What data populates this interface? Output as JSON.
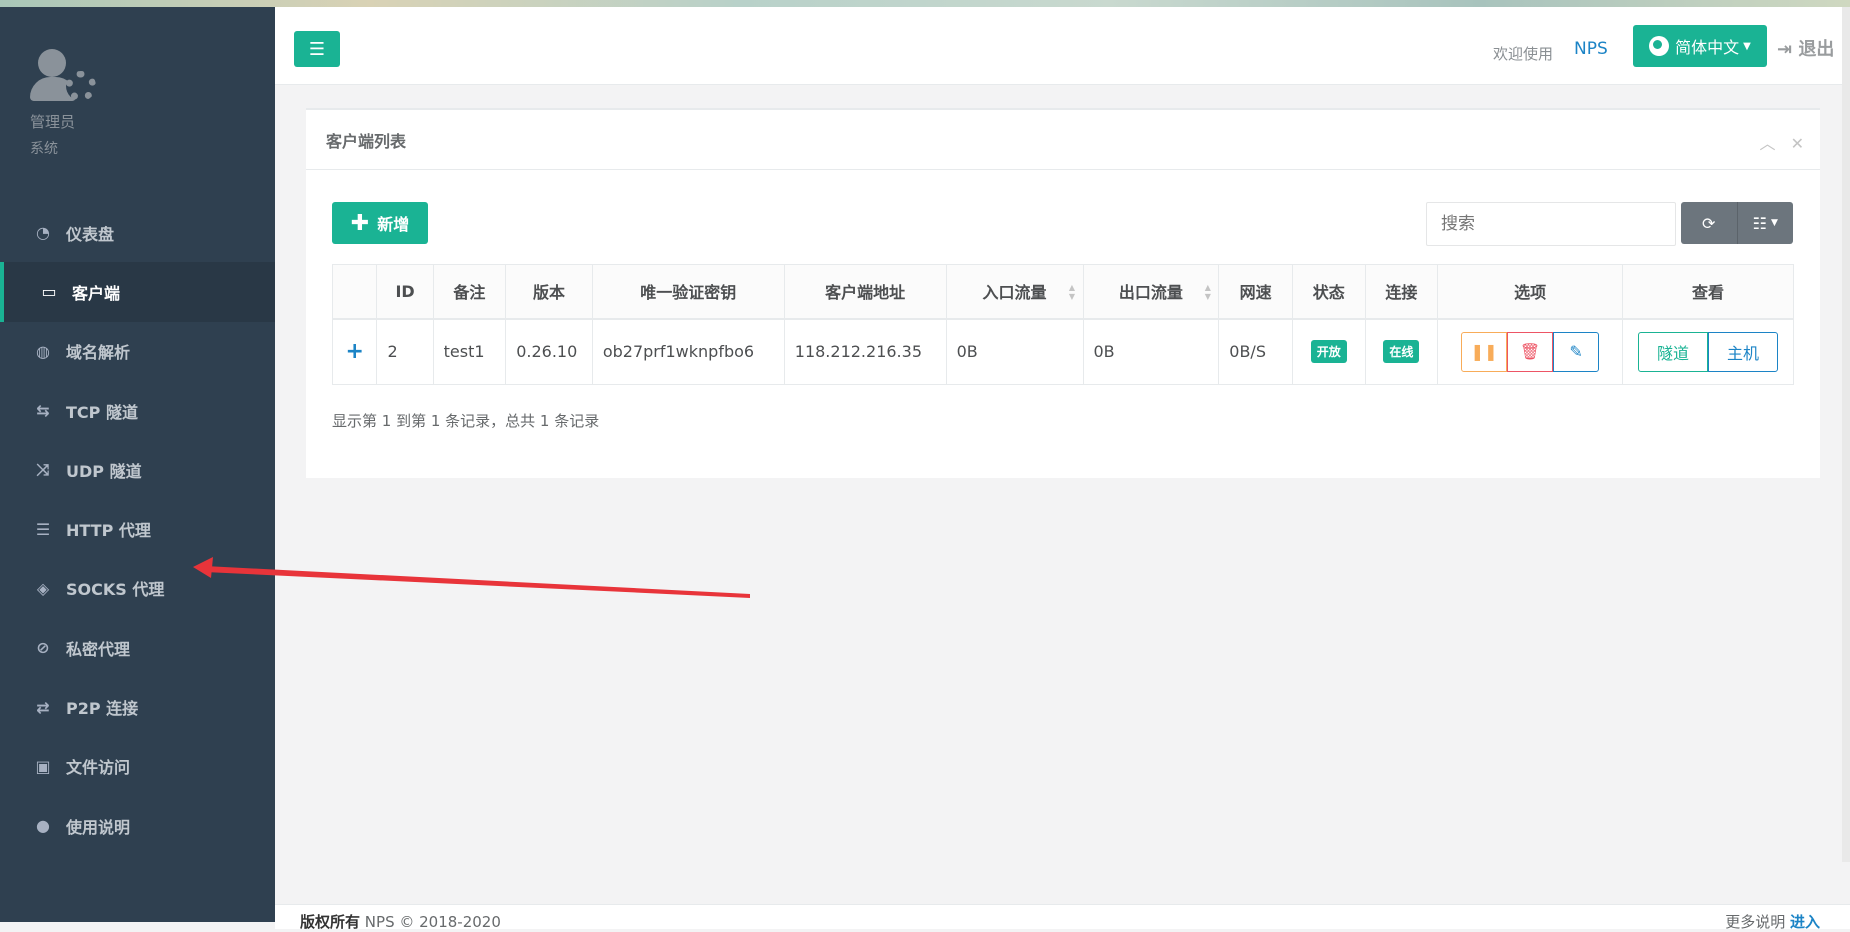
{
  "sidebar": {
    "role": "管理员",
    "sub": "系统",
    "items": [
      {
        "label": "仪表盘",
        "icon": "dashboard-icon"
      },
      {
        "label": "客户端",
        "icon": "desktop-icon"
      },
      {
        "label": "域名解析",
        "icon": "globe-icon"
      },
      {
        "label": "TCP 隧道",
        "icon": "retweet-icon"
      },
      {
        "label": "UDP 隧道",
        "icon": "random-icon"
      },
      {
        "label": "HTTP 代理",
        "icon": "server-icon"
      },
      {
        "label": "SOCKS 代理",
        "icon": "layers-icon"
      },
      {
        "label": "私密代理",
        "icon": "eye-slash-icon"
      },
      {
        "label": "P2P 连接",
        "icon": "exchange-icon"
      },
      {
        "label": "文件访问",
        "icon": "briefcase-icon"
      },
      {
        "label": "使用说明",
        "icon": "lightbulb-icon"
      }
    ]
  },
  "header": {
    "welcome": "欢迎使用",
    "brand": "NPS",
    "language": "简体中文",
    "logout": "退出"
  },
  "card": {
    "title": "客户端列表",
    "add_label": "新增",
    "search_placeholder": "搜索",
    "columns": [
      "ID",
      "备注",
      "版本",
      "唯一验证密钥",
      "客户端地址",
      "入口流量",
      "出口流量",
      "网速",
      "状态",
      "连接",
      "选项",
      "查看"
    ],
    "rows": [
      {
        "id": "2",
        "remark": "test1",
        "version": "0.26.10",
        "key": "ob27prf1wknpfbo6",
        "address": "118.212.216.35",
        "in_flow": "0B",
        "out_flow": "0B",
        "rate": "0B/S",
        "status": "开放",
        "connection": "在线",
        "view_tunnel": "隧道",
        "view_host": "主机"
      }
    ],
    "summary": "显示第 1 到第 1 条记录，总共 1 条记录"
  },
  "footer": {
    "copyright_bold": "版权所有",
    "copyright": "NPS © 2018-2020",
    "more_label": "更多说明",
    "more_link": "进入"
  },
  "colors": {
    "sidebar": "#2f4050",
    "accent": "#1ab394",
    "link": "#1c84c6",
    "annotation_arrow": "#e8343a"
  }
}
